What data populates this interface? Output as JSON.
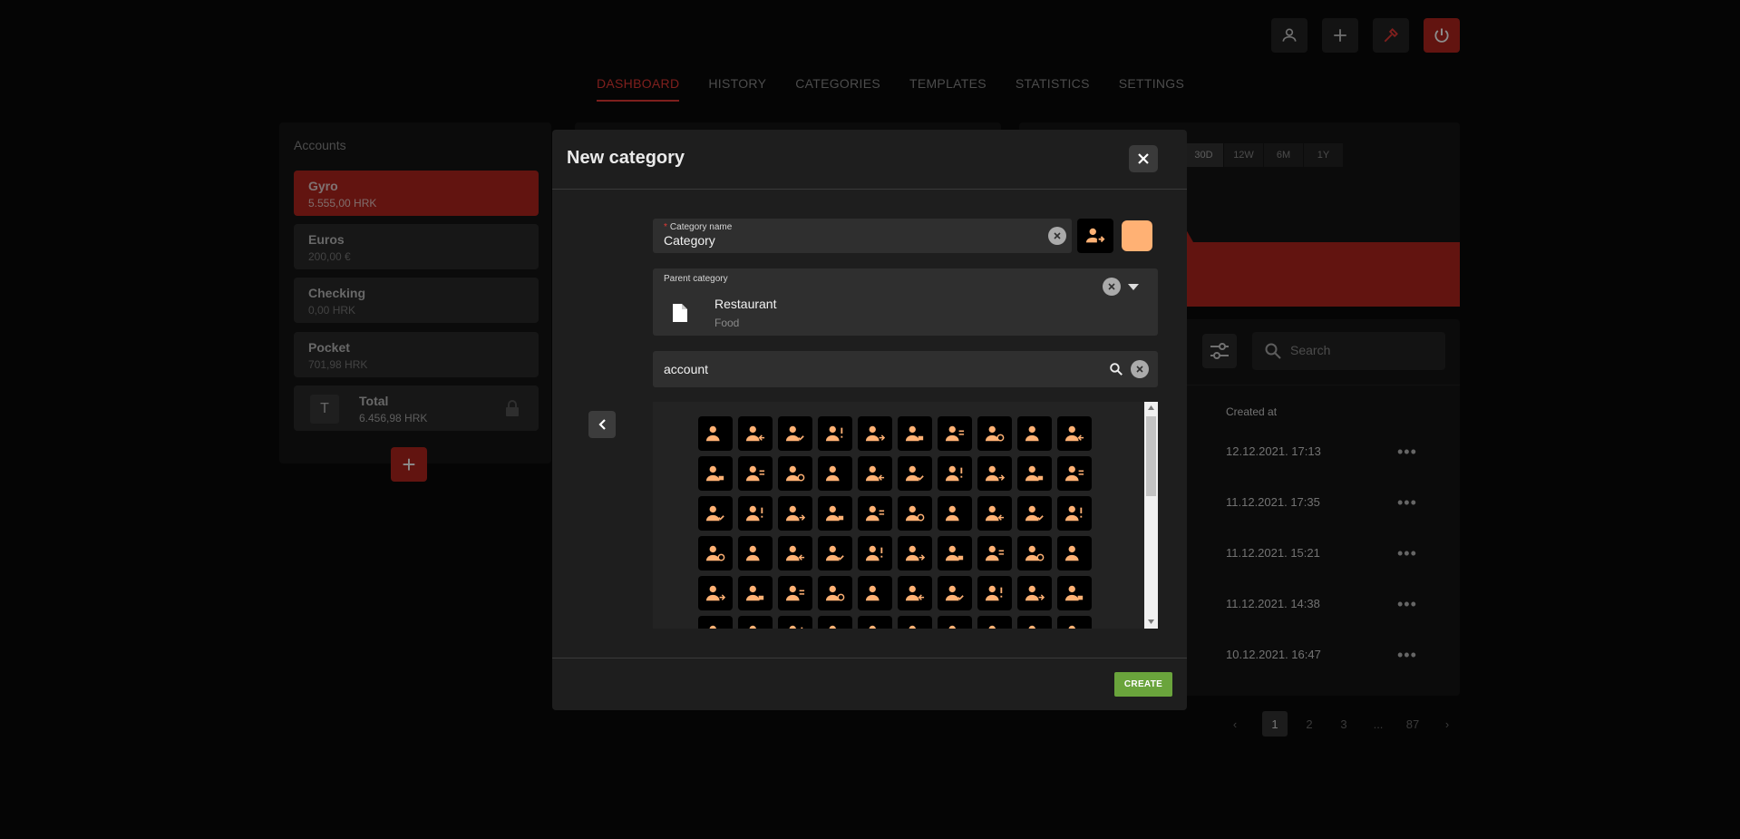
{
  "colors": {
    "accent": "#e53935",
    "accent_dark": "#b3261e",
    "icon": "#ffb174",
    "create": "#6aa43c"
  },
  "top_buttons": [
    {
      "name": "profile-icon"
    },
    {
      "name": "add-icon"
    },
    {
      "name": "color-picker-icon"
    },
    {
      "name": "power-icon"
    }
  ],
  "nav": {
    "tabs": [
      "DASHBOARD",
      "HISTORY",
      "CATEGORIES",
      "TEMPLATES",
      "STATISTICS",
      "SETTINGS"
    ],
    "active": "DASHBOARD"
  },
  "accounts": {
    "title": "Accounts",
    "items": [
      {
        "name": "Gyro",
        "value": "5.555,00 HRK"
      },
      {
        "name": "Euros",
        "value": "200,00 €"
      },
      {
        "name": "Checking",
        "value": "0,00 HRK"
      },
      {
        "name": "Pocket",
        "value": "701,98 HRK"
      }
    ],
    "total": {
      "avatar": "T",
      "name": "Total",
      "value": "6.456,98 HRK"
    },
    "add_label": "+"
  },
  "chart": {
    "ranges": [
      "30D",
      "12W",
      "6M",
      "1Y"
    ],
    "selected": "30D"
  },
  "history": {
    "search_placeholder": "Search",
    "column_header": "Created at",
    "dates": [
      "12.12.2021. 17:13",
      "11.12.2021. 17:35",
      "11.12.2021. 15:21",
      "11.12.2021. 14:38",
      "10.12.2021. 16:47"
    ],
    "more_label": "•••",
    "pagination": [
      "‹",
      "1",
      "2",
      "3",
      "...",
      "87",
      "›"
    ]
  },
  "modal": {
    "title": "New category",
    "category_name": {
      "label": "Category name",
      "value": "Category"
    },
    "parent_category": {
      "label": "Parent category",
      "name": "Restaurant",
      "sub": "Food"
    },
    "icon_search": {
      "value": "account"
    },
    "create_label": "CREATE"
  }
}
